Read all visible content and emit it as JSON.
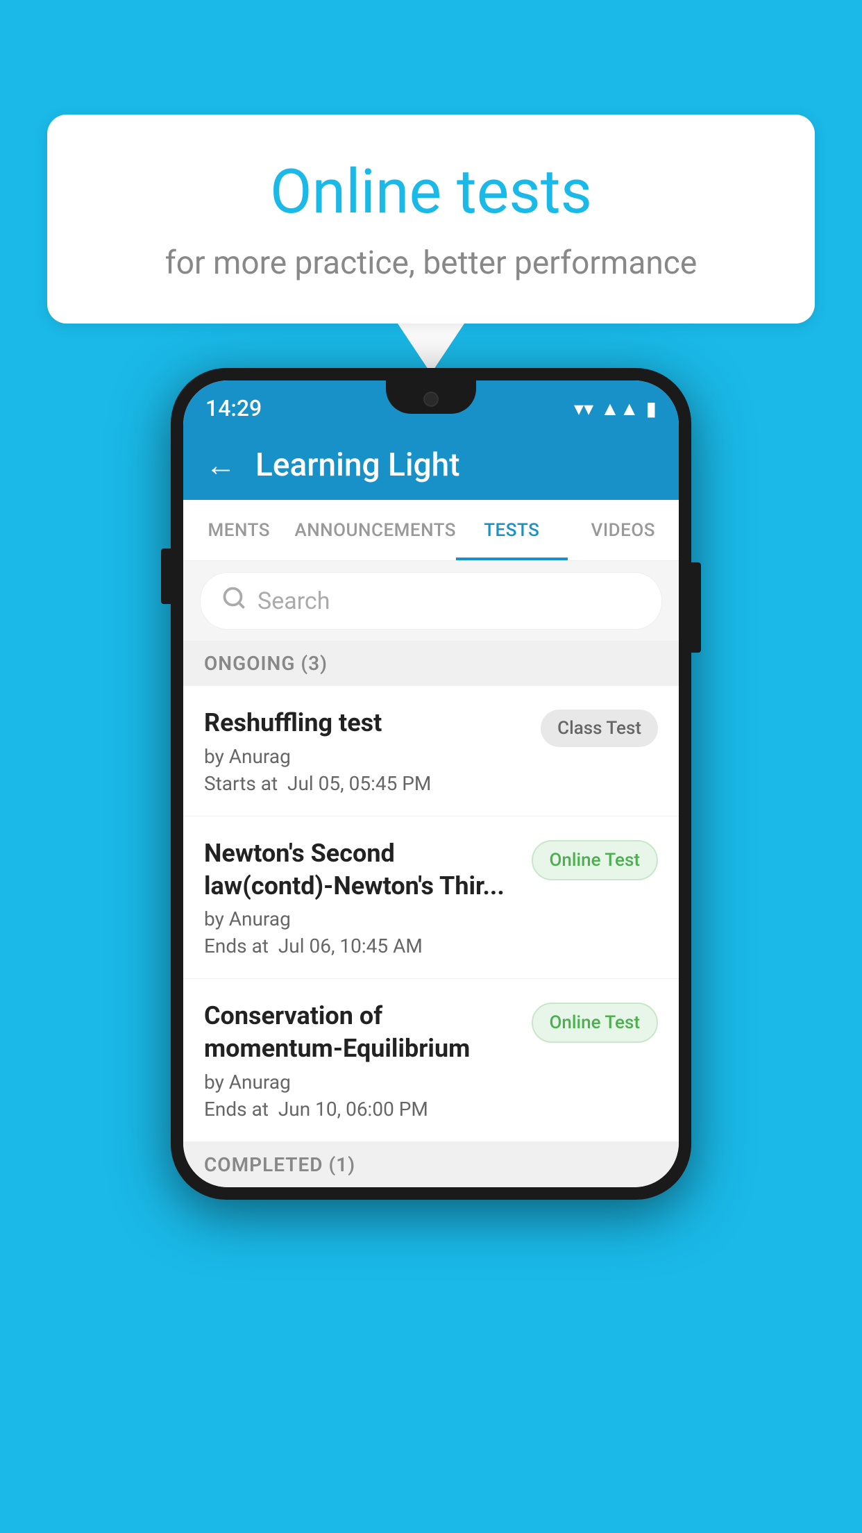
{
  "background": {
    "color": "#1ab9e8"
  },
  "speech_bubble": {
    "title": "Online tests",
    "subtitle": "for more practice, better performance"
  },
  "phone": {
    "status_bar": {
      "time": "14:29",
      "wifi": "▼",
      "signal": "▲",
      "battery": "▮"
    },
    "header": {
      "back_label": "←",
      "title": "Learning Light"
    },
    "tabs": [
      {
        "label": "MENTS",
        "active": false
      },
      {
        "label": "ANNOUNCEMENTS",
        "active": false
      },
      {
        "label": "TESTS",
        "active": true
      },
      {
        "label": "VIDEOS",
        "active": false
      }
    ],
    "search": {
      "placeholder": "Search"
    },
    "ongoing_section": {
      "title": "ONGOING (3)"
    },
    "tests": [
      {
        "name": "Reshuffling test",
        "author": "by Anurag",
        "time_label": "Starts at",
        "time": "Jul 05, 05:45 PM",
        "badge": "Class Test",
        "badge_type": "class"
      },
      {
        "name": "Newton's Second law(contd)-Newton's Thir...",
        "author": "by Anurag",
        "time_label": "Ends at",
        "time": "Jul 06, 10:45 AM",
        "badge": "Online Test",
        "badge_type": "online"
      },
      {
        "name": "Conservation of momentum-Equilibrium",
        "author": "by Anurag",
        "time_label": "Ends at",
        "time": "Jun 10, 06:00 PM",
        "badge": "Online Test",
        "badge_type": "online"
      }
    ],
    "completed_section": {
      "title": "COMPLETED (1)"
    }
  }
}
